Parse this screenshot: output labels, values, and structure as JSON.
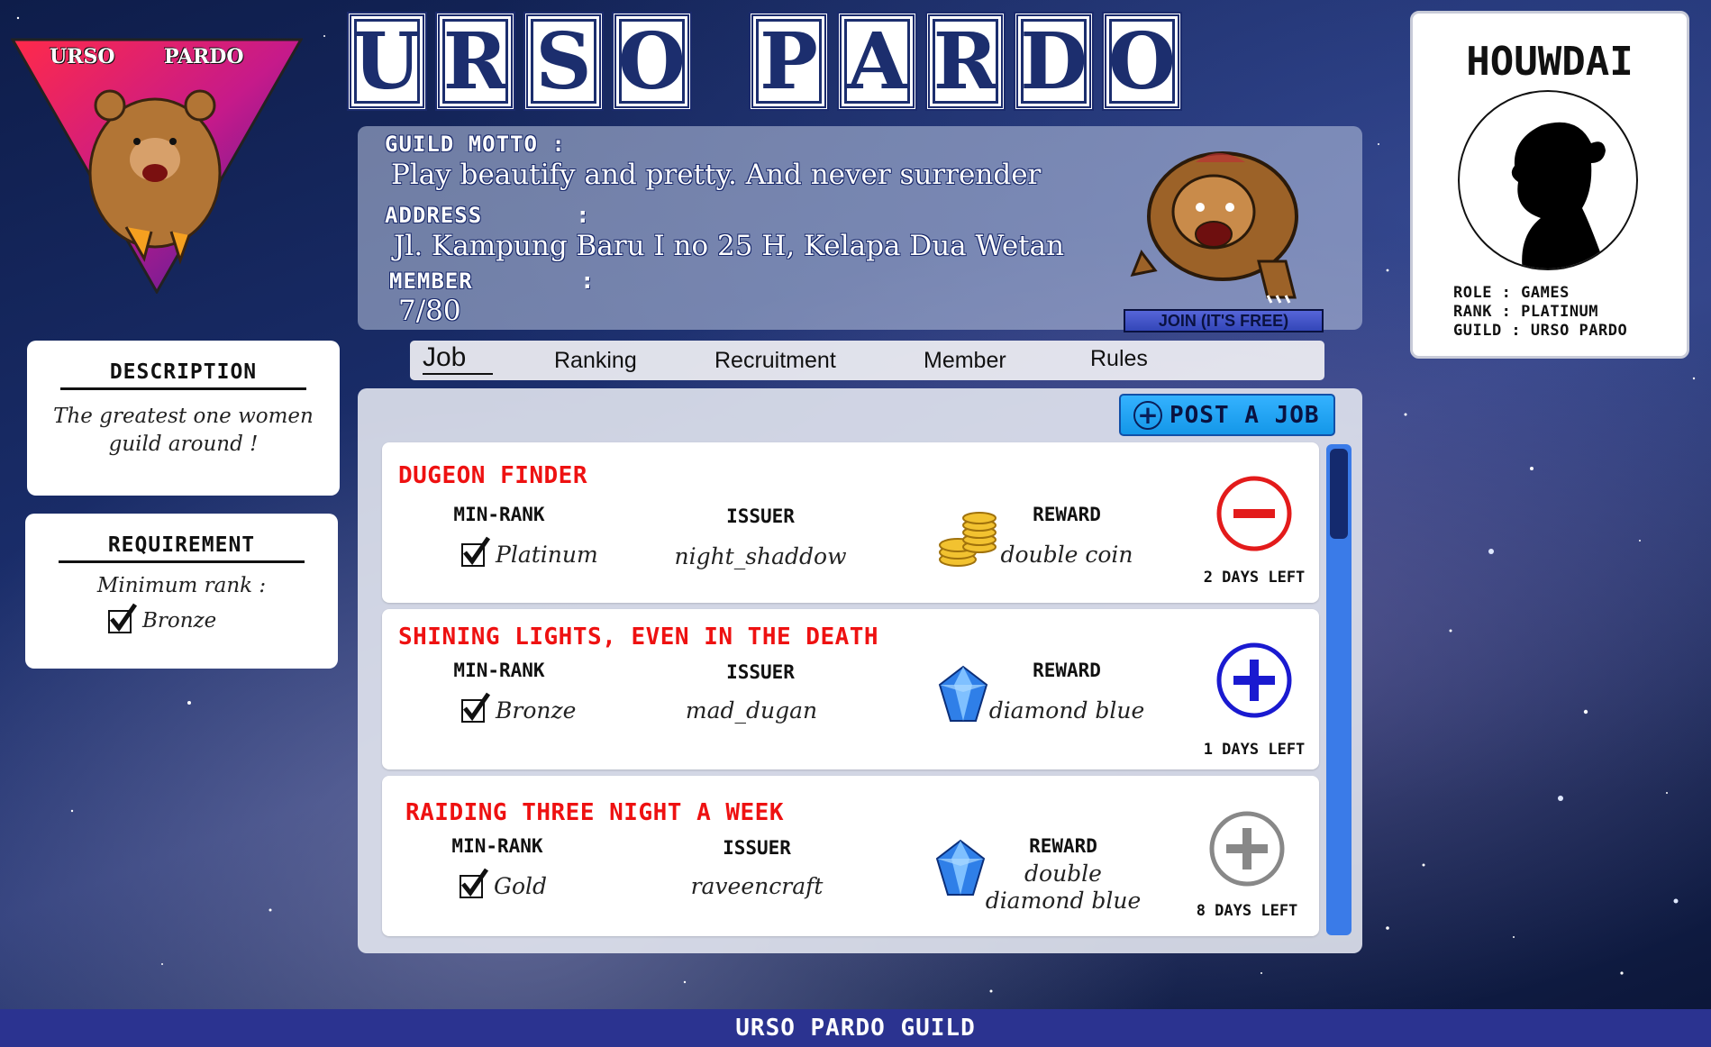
{
  "brand": {
    "title_letters": [
      "U",
      "R",
      "S",
      "O",
      "",
      "P",
      "A",
      "R",
      "D",
      "O"
    ],
    "logo_text_left": "URSO",
    "logo_text_right": "PARDO"
  },
  "info": {
    "motto_label": "GUILD MOTTO :",
    "motto": "Play beautify and pretty. And never surrender",
    "address_label": "ADDRESS",
    "address": "Jl. Kampung Baru I no 25 H, Kelapa Dua Wetan",
    "member_label": "MEMBER",
    "member": "7/80",
    "colon": ":",
    "join_label": "JOIN (IT'S FREE)"
  },
  "profile": {
    "name": "HOUWDAI",
    "role": "ROLE : GAMES",
    "rank": "RANK : PLATINUM",
    "guild": "GUILD : URSO PARDO"
  },
  "description": {
    "title": "DESCRIPTION",
    "line1": "The greatest one women",
    "line2": "guild around !"
  },
  "requirement": {
    "title": "REQUIREMENT",
    "label": "Minimum rank :",
    "rank": "Bronze"
  },
  "tabs": [
    "Job",
    "Ranking",
    "Recruitment",
    "Member",
    "Rules"
  ],
  "post_job_label": "POST A JOB",
  "jobs": [
    {
      "title": "DUGEON FINDER",
      "min_rank_label": "MIN-RANK",
      "min_rank": "Platinum",
      "issuer_label": "ISSUER",
      "issuer": "night_shaddow",
      "reward_label": "REWARD",
      "reward_line1": "double coin",
      "reward_line2": "",
      "reward_icon": "gold-coins-icon",
      "action_icon": "minus-circle-icon",
      "action_color": "#e31b1b",
      "days_left": "2 DAYS LEFT"
    },
    {
      "title": "SHINING LIGHTS, EVEN IN THE DEATH",
      "min_rank_label": "MIN-RANK",
      "min_rank": "Bronze",
      "issuer_label": "ISSUER",
      "issuer": "mad_dugan",
      "reward_label": "REWARD",
      "reward_line1": "diamond blue",
      "reward_line2": "",
      "reward_icon": "blue-diamond-icon",
      "action_icon": "plus-circle-icon",
      "action_color": "#1a1ad0",
      "days_left": "1 DAYS LEFT"
    },
    {
      "title": "RAIDING THREE NIGHT A WEEK",
      "min_rank_label": "MIN-RANK",
      "min_rank": "Gold",
      "issuer_label": "ISSUER",
      "issuer": "raveencraft",
      "reward_label": "REWARD",
      "reward_line1": "double",
      "reward_line2": "diamond blue",
      "reward_icon": "blue-diamond-icon",
      "action_icon": "plus-circle-icon",
      "action_color": "#888888",
      "days_left": "8 DAYS LEFT"
    }
  ],
  "footer": "URSO PARDO GUILD"
}
